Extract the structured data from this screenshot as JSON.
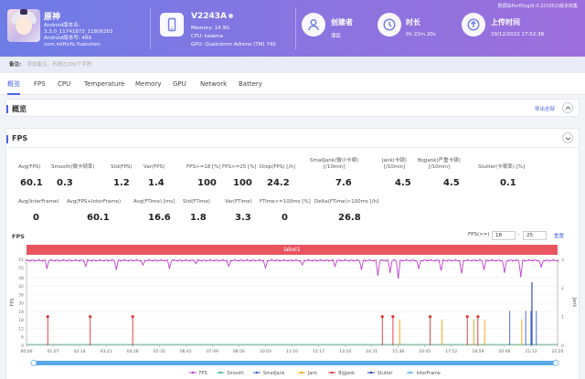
{
  "header": {
    "app": {
      "name": "原神",
      "android_version": "Android版本名:",
      "version": "3.3.0_11741873_11806263",
      "android_version_code": "Android版本号: 489",
      "package": "com.miHoYo.Yuanshen"
    },
    "device": {
      "name": "V2243A",
      "memory": "Memory: 14.9G",
      "cpu": "CPU: kalama",
      "gpu": "GPU: Qualcomm Adreno (TM) 740"
    },
    "creator": {
      "label": "创建者",
      "value": "漂民"
    },
    "duration": {
      "label": "时长",
      "value": "0h 22m 20s"
    },
    "upload": {
      "label": "上传时间",
      "value": "29/12/2022 17:52:38"
    },
    "tool_version": "数据由PerfDog(6.0.221052)版本收集"
  },
  "remark": {
    "label": "备注:",
    "placeholder": "添加备注，不超过200个字符"
  },
  "tabs": [
    "概览",
    "FPS",
    "CPU",
    "Temperature",
    "Memory",
    "GPU",
    "Network",
    "Battery"
  ],
  "overview": {
    "title": "概览",
    "export": "导出全部"
  },
  "fps_panel": {
    "title": "FPS",
    "row1": [
      {
        "label": "Avg(FPS)",
        "value": "60.1"
      },
      {
        "label": "Smooth(微卡顿率)",
        "value": "0.3"
      },
      {
        "label": "Std(FPS)",
        "value": "1.2"
      },
      {
        "label": "Var(FPS)",
        "value": "1.4"
      },
      {
        "label": "FPS>=18 [%]",
        "value": "100"
      },
      {
        "label": "FPS>=25 [%]",
        "value": "100"
      },
      {
        "label": "Drop(FPS) [/h]",
        "value": "24.2"
      },
      {
        "label": "SmallJank(微小卡顿)\n[/10min]",
        "value": "7.6"
      },
      {
        "label": "Jank(卡顿)\n[/10min]",
        "value": "4.5"
      },
      {
        "label": "BigJank(严重卡顿)\n[/10min]",
        "value": "4.5"
      },
      {
        "label": "Stutter(卡顿率) [%]",
        "value": "0.1"
      }
    ],
    "row2": [
      {
        "label": "Avg(InterFrame)",
        "value": "0"
      },
      {
        "label": "Avg(FPS+InterFrame)",
        "value": "60.1"
      },
      {
        "label": "Avg(FTime) [ms]",
        "value": "16.6"
      },
      {
        "label": "Std(FTime)",
        "value": "1.8"
      },
      {
        "label": "Var(FTime)",
        "value": "3.3"
      },
      {
        "label": "FTime>=100ms [%]",
        "value": "0"
      },
      {
        "label": "Delta(FTime)>100ms [/h]",
        "value": "26.8"
      }
    ],
    "chart_title": "FPS",
    "fps_filter_label": "FPS(>=)",
    "fps_min": "18",
    "fps_max": "25",
    "reset": "重置",
    "label_bar": "label1"
  },
  "chart_data": {
    "type": "line",
    "ylabel": "FPS",
    "y2label": "Jank",
    "y_ticks": [
      0,
      6,
      12,
      18,
      24,
      30,
      36,
      42,
      48,
      55,
      61
    ],
    "y2_ticks": [
      0,
      1,
      2,
      3
    ],
    "ylim": [
      0,
      61
    ],
    "y2lim": [
      0,
      3
    ],
    "x_ticks": [
      "00:00",
      "01:07",
      "02:14",
      "03:21",
      "04:28",
      "05:35",
      "06:42",
      "07:49",
      "08:56",
      "10:03",
      "11:10",
      "12:17",
      "13:24",
      "14:31",
      "15:38",
      "16:45",
      "17:52",
      "18:59",
      "20:06",
      "21:13",
      "22:20"
    ],
    "fps_baseline": 60,
    "fps_dips": [
      {
        "t": 0.04,
        "v": 55
      },
      {
        "t": 0.11,
        "v": 56
      },
      {
        "t": 0.17,
        "v": 54
      },
      {
        "t": 0.22,
        "v": 57
      },
      {
        "t": 0.27,
        "v": 55
      },
      {
        "t": 0.32,
        "v": 58
      },
      {
        "t": 0.38,
        "v": 56
      },
      {
        "t": 0.45,
        "v": 55
      },
      {
        "t": 0.52,
        "v": 57
      },
      {
        "t": 0.58,
        "v": 56
      },
      {
        "t": 0.63,
        "v": 54
      },
      {
        "t": 0.66,
        "v": 50
      },
      {
        "t": 0.685,
        "v": 52
      },
      {
        "t": 0.7,
        "v": 48
      },
      {
        "t": 0.74,
        "v": 55
      },
      {
        "t": 0.78,
        "v": 53
      },
      {
        "t": 0.82,
        "v": 51
      },
      {
        "t": 0.86,
        "v": 54
      },
      {
        "t": 0.9,
        "v": 52
      },
      {
        "t": 0.93,
        "v": 49
      },
      {
        "t": 0.97,
        "v": 56
      }
    ],
    "bigjank_events": [
      0.04,
      0.12,
      0.2,
      0.67,
      0.69,
      0.76,
      0.83,
      0.85
    ],
    "jank_events": [
      0.7,
      0.78,
      0.84,
      0.86,
      0.93
    ],
    "smalljank_events": [
      0.91,
      0.94,
      0.95,
      0.96
    ],
    "stutter_events": [
      0.95
    ],
    "legend": [
      "FPS",
      "Smooth",
      "SmallJank",
      "Jank",
      "BigJank",
      "Stutter",
      "InterFrame"
    ],
    "colors": {
      "FPS": "#c23fcf",
      "Smooth": "#36b37e",
      "SmallJank": "#3b5bdb",
      "Jank": "#f59f00",
      "BigJank": "#e03131",
      "Stutter": "#1c3fa8",
      "InterFrame": "#4dabf7"
    },
    "grid": true
  }
}
